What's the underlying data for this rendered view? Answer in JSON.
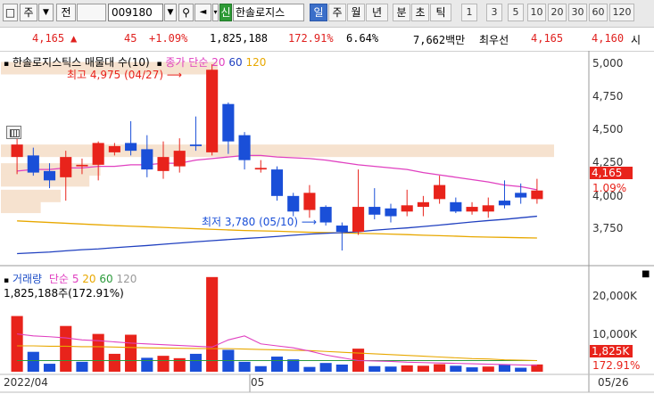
{
  "toolbar": {
    "left_icon": "square-icon",
    "type_label": "주",
    "type_arrow": "▼",
    "market_label": "전",
    "code": "009180",
    "dropdown_arrow": "▼",
    "search_icon": "search-icon",
    "sound_icon": "speaker-icon",
    "new_label": "신",
    "stock_name": "한솔로지스",
    "periods": [
      "일",
      "주",
      "월",
      "년",
      "분",
      "초",
      "틱"
    ],
    "active_period": "일",
    "intervals": [
      "1",
      "3",
      "5",
      "10",
      "20",
      "30",
      "60",
      "120"
    ]
  },
  "quote": {
    "price": "4,165",
    "change_arrow": "▲",
    "change": "45",
    "change_pct": "+1.09%",
    "volume": "1,825,188",
    "volume_pct": "172.91%",
    "turnover": "6.64%",
    "amount": "7,662백만",
    "order_type": "최우선",
    "ask": "4,165",
    "bid": "4,160",
    "tail": "시"
  },
  "price_panel": {
    "title": "한솔로지스틱스 매물대 수(10)",
    "ma_label": "종가 단순",
    "ma_periods": [
      "20",
      "60",
      "120"
    ],
    "high_label": "최고 4,975 (04/27)",
    "low_label": "최저 3,780 (05/10)",
    "axis_ticks": [
      "5,000",
      "4,750",
      "4,500",
      "4,250",
      "4,000",
      "3,750"
    ],
    "current_price_tag": "4,165",
    "current_pct_tag": "1.09%"
  },
  "volume_panel": {
    "title": "거래량",
    "ma_label": "단순",
    "ma_periods": [
      "5",
      "20",
      "60",
      "120"
    ],
    "value_label": "1,825,188주(172.91%)",
    "axis_ticks": [
      "20,000K",
      "10,000K"
    ],
    "current_tag": "1,825K",
    "current_pct_tag": "172.91%",
    "corner_icon": "close-icon"
  },
  "x_axis": {
    "labels": [
      "2022/04",
      "05",
      "05/26"
    ]
  },
  "colors": {
    "up": "#e8231b",
    "down": "#1a4fd8",
    "ma20": "#e040c0",
    "ma60": "#2040c0",
    "ma120": "#e8a800",
    "volume_profile": "#f6e2cf"
  },
  "chart_data": {
    "type": "candlestick",
    "price_candles": [
      {
        "o": 4380,
        "h": 4500,
        "l": 4270,
        "c": 4460,
        "up": true
      },
      {
        "o": 4390,
        "h": 4440,
        "l": 4260,
        "c": 4280,
        "up": false
      },
      {
        "o": 4290,
        "h": 4340,
        "l": 4180,
        "c": 4230,
        "up": false
      },
      {
        "o": 4250,
        "h": 4420,
        "l": 4100,
        "c": 4380,
        "up": true
      },
      {
        "o": 4330,
        "h": 4370,
        "l": 4270,
        "c": 4320,
        "up": true
      },
      {
        "o": 4330,
        "h": 4480,
        "l": 4230,
        "c": 4470,
        "up": true
      },
      {
        "o": 4450,
        "h": 4470,
        "l": 4390,
        "c": 4410,
        "up": true
      },
      {
        "o": 4470,
        "h": 4610,
        "l": 4390,
        "c": 4420,
        "up": false
      },
      {
        "o": 4430,
        "h": 4520,
        "l": 4250,
        "c": 4300,
        "up": false
      },
      {
        "o": 4290,
        "h": 4480,
        "l": 4240,
        "c": 4380,
        "up": true
      },
      {
        "o": 4420,
        "h": 4500,
        "l": 4280,
        "c": 4320,
        "up": true
      },
      {
        "o": 4450,
        "h": 4640,
        "l": 4420,
        "c": 4460,
        "up": false
      },
      {
        "o": 4410,
        "h": 4975,
        "l": 4390,
        "c": 4940,
        "up": true
      },
      {
        "o": 4720,
        "h": 4730,
        "l": 4400,
        "c": 4480,
        "up": false
      },
      {
        "o": 4520,
        "h": 4540,
        "l": 4300,
        "c": 4360,
        "up": false
      },
      {
        "o": 4310,
        "h": 4360,
        "l": 4280,
        "c": 4300,
        "up": true
      },
      {
        "o": 4300,
        "h": 4320,
        "l": 4100,
        "c": 4130,
        "up": false
      },
      {
        "o": 4130,
        "h": 4150,
        "l": 4000,
        "c": 4030,
        "up": false
      },
      {
        "o": 4040,
        "h": 4200,
        "l": 3990,
        "c": 4150,
        "up": true
      },
      {
        "o": 4060,
        "h": 4070,
        "l": 3940,
        "c": 3960,
        "up": false
      },
      {
        "o": 3940,
        "h": 3960,
        "l": 3780,
        "c": 3900,
        "up": false
      },
      {
        "o": 3900,
        "h": 4300,
        "l": 3880,
        "c": 4060,
        "up": true
      },
      {
        "o": 4060,
        "h": 4180,
        "l": 3980,
        "c": 4010,
        "up": false
      },
      {
        "o": 4050,
        "h": 4080,
        "l": 3960,
        "c": 4000,
        "up": false
      },
      {
        "o": 4030,
        "h": 4170,
        "l": 4000,
        "c": 4070,
        "up": true
      },
      {
        "o": 4060,
        "h": 4130,
        "l": 4000,
        "c": 4090,
        "up": true
      },
      {
        "o": 4110,
        "h": 4260,
        "l": 4080,
        "c": 4200,
        "up": true
      },
      {
        "o": 4090,
        "h": 4120,
        "l": 4020,
        "c": 4030,
        "up": false
      },
      {
        "o": 4030,
        "h": 4090,
        "l": 4010,
        "c": 4060,
        "up": true
      },
      {
        "o": 4030,
        "h": 4120,
        "l": 3990,
        "c": 4070,
        "up": true
      },
      {
        "o": 4070,
        "h": 4230,
        "l": 4050,
        "c": 4100,
        "up": false
      },
      {
        "o": 4120,
        "h": 4210,
        "l": 4080,
        "c": 4150,
        "up": false
      },
      {
        "o": 4110,
        "h": 4240,
        "l": 4080,
        "c": 4165,
        "up": true
      }
    ],
    "ma20": [
      4290,
      4300,
      4300,
      4310,
      4310,
      4320,
      4320,
      4330,
      4330,
      4340,
      4340,
      4360,
      4370,
      4380,
      4390,
      4390,
      4380,
      4375,
      4370,
      4360,
      4345,
      4330,
      4320,
      4310,
      4300,
      4280,
      4265,
      4250,
      4235,
      4220,
      4200,
      4190,
      4170
    ],
    "ma60": [
      3760,
      3765,
      3770,
      3778,
      3785,
      3790,
      3798,
      3805,
      3812,
      3820,
      3828,
      3836,
      3843,
      3850,
      3857,
      3863,
      3870,
      3878,
      3885,
      3890,
      3895,
      3900,
      3910,
      3918,
      3925,
      3934,
      3943,
      3953,
      3963,
      3972,
      3980,
      3990,
      4000
    ],
    "ma120": [
      3970,
      3965,
      3960,
      3955,
      3950,
      3945,
      3940,
      3936,
      3932,
      3928,
      3924,
      3920,
      3916,
      3912,
      3908,
      3906,
      3904,
      3900,
      3897,
      3895,
      3893,
      3890,
      3888,
      3885,
      3882,
      3878,
      3875,
      3872,
      3868,
      3866,
      3864,
      3862,
      3860
    ],
    "volume_profile": [
      {
        "price": 4950,
        "strength": 0.98
      },
      {
        "price": 4420,
        "strength": 2.5
      },
      {
        "price": 4300,
        "strength": 0.45
      },
      {
        "price": 4230,
        "strength": 0.4
      },
      {
        "price": 4130,
        "strength": 0.27
      },
      {
        "price": 4060,
        "strength": 0.18
      }
    ],
    "volume": [
      {
        "v": 14000,
        "up": true
      },
      {
        "v": 5000,
        "up": false
      },
      {
        "v": 2000,
        "up": false
      },
      {
        "v": 11500,
        "up": true
      },
      {
        "v": 2500,
        "up": false
      },
      {
        "v": 9500,
        "up": true
      },
      {
        "v": 4500,
        "up": true
      },
      {
        "v": 9300,
        "up": true
      },
      {
        "v": 3500,
        "up": false
      },
      {
        "v": 4000,
        "up": true
      },
      {
        "v": 3400,
        "up": true
      },
      {
        "v": 4500,
        "up": false
      },
      {
        "v": 23800,
        "up": true
      },
      {
        "v": 5500,
        "up": false
      },
      {
        "v": 2500,
        "up": false
      },
      {
        "v": 1400,
        "up": false
      },
      {
        "v": 3800,
        "up": false
      },
      {
        "v": 3100,
        "up": false
      },
      {
        "v": 1200,
        "up": false
      },
      {
        "v": 2200,
        "up": false
      },
      {
        "v": 1800,
        "up": false
      },
      {
        "v": 5800,
        "up": true
      },
      {
        "v": 1400,
        "up": false
      },
      {
        "v": 1300,
        "up": false
      },
      {
        "v": 1600,
        "up": true
      },
      {
        "v": 1500,
        "up": true
      },
      {
        "v": 1900,
        "up": true
      },
      {
        "v": 1500,
        "up": false
      },
      {
        "v": 1100,
        "up": false
      },
      {
        "v": 1300,
        "up": true
      },
      {
        "v": 1900,
        "up": false
      },
      {
        "v": 1000,
        "up": false
      },
      {
        "v": 1825,
        "up": true
      }
    ],
    "vol_ma5": [
      9500,
      9000,
      8800,
      8500,
      8000,
      7800,
      7500,
      7200,
      7000,
      6800,
      6600,
      6400,
      6200,
      8000,
      9000,
      7000,
      6500,
      6000,
      5200,
      4200,
      3500,
      2800,
      2700,
      2600,
      2400,
      2300,
      2200,
      2100,
      2000,
      1900,
      1800,
      1700,
      1600
    ],
    "vol_ma20": [
      6500,
      6500,
      6400,
      6400,
      6300,
      6300,
      6200,
      6100,
      6000,
      5950,
      5900,
      5850,
      5800,
      5800,
      5700,
      5600,
      5500,
      5400,
      5300,
      5100,
      4900,
      4700,
      4500,
      4300,
      4100,
      3900,
      3700,
      3500,
      3300,
      3200,
      3000,
      2900,
      2800
    ],
    "vol_ma60": [
      2800,
      2800,
      2800,
      2800,
      2800,
      2800,
      2800,
      2800,
      2800,
      2800,
      2800,
      2800,
      2800,
      2800,
      2800,
      2800,
      2800,
      2800,
      2800,
      2800,
      2800,
      2800,
      2800,
      2800,
      2800,
      2800,
      2800,
      2800,
      2800,
      2800,
      2800,
      2800,
      2800
    ],
    "y_price_range": [
      3700,
      5050
    ],
    "y_volume_range": [
      0,
      26000
    ]
  }
}
